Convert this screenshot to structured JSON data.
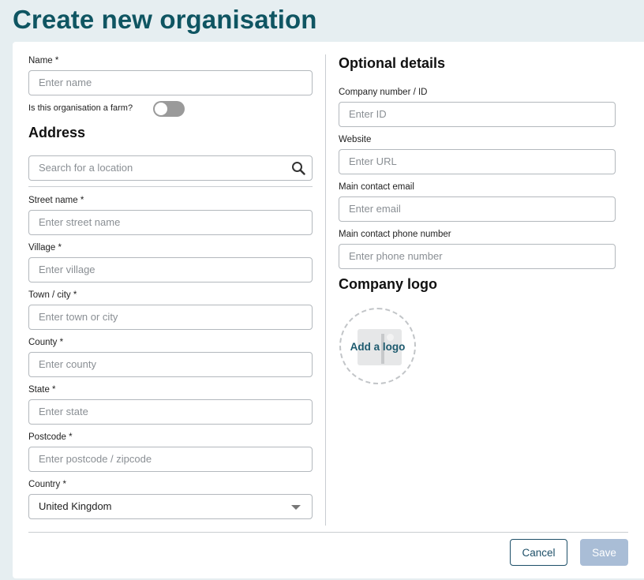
{
  "page": {
    "title": "Create new organisation"
  },
  "left": {
    "name": {
      "label": "Name *",
      "placeholder": "Enter name"
    },
    "farm_toggle": {
      "label": "Is this organisation a farm?",
      "state": "off"
    },
    "address_heading": "Address",
    "location_search": {
      "placeholder": "Search for a location"
    },
    "street": {
      "label": "Street name *",
      "placeholder": "Enter street name"
    },
    "village": {
      "label": "Village *",
      "placeholder": "Enter village"
    },
    "town": {
      "label": "Town / city *",
      "placeholder": "Enter town or city"
    },
    "county": {
      "label": "County *",
      "placeholder": "Enter county"
    },
    "state": {
      "label": "State *",
      "placeholder": "Enter state"
    },
    "postcode": {
      "label": "Postcode *",
      "placeholder": "Enter postcode / zipcode"
    },
    "country": {
      "label": "Country *",
      "value": "United Kingdom"
    }
  },
  "right": {
    "optional_heading": "Optional details",
    "company_id": {
      "label": "Company number / ID",
      "placeholder": "Enter ID"
    },
    "website": {
      "label": "Website",
      "placeholder": "Enter URL"
    },
    "email": {
      "label": "Main contact email",
      "placeholder": "Enter email"
    },
    "phone": {
      "label": "Main contact phone number",
      "placeholder": "Enter phone number"
    },
    "logo_heading": "Company logo",
    "add_logo_label": "Add a logo"
  },
  "footer": {
    "cancel_label": "Cancel",
    "save_label": "Save"
  },
  "colors": {
    "title": "#0f5562",
    "save_disabled": "#a9bdd6",
    "cancel_border": "#1d4f68"
  },
  "icons": {
    "search": "search-icon",
    "dropdown": "chevron-down-icon",
    "logo_placeholder": "image-placeholder-icon"
  }
}
